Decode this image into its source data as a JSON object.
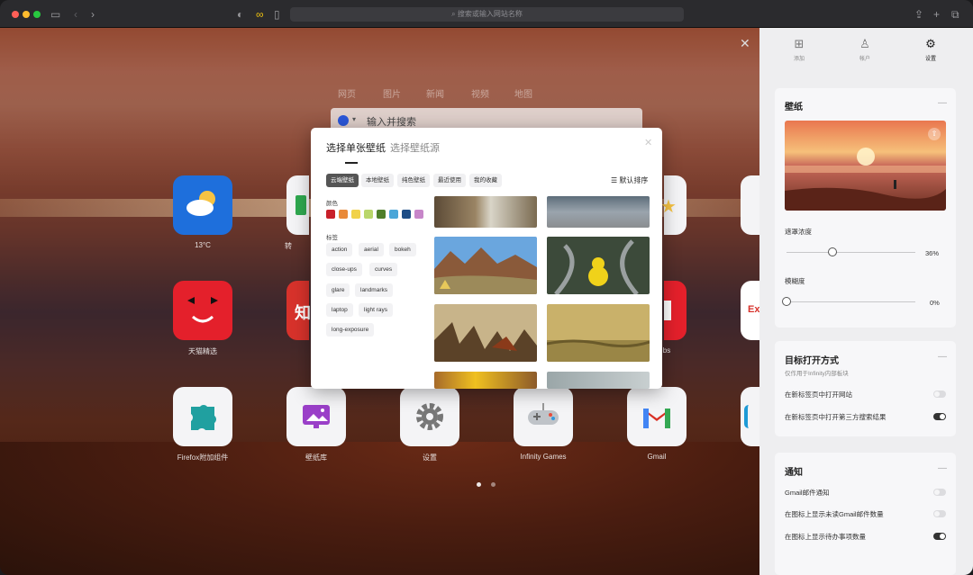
{
  "toolbar": {
    "url_placeholder": "搜索或输入网站名称"
  },
  "new_tab": {
    "search_tabs": [
      "网页",
      "图片",
      "新闻",
      "视频",
      "地图"
    ],
    "search_placeholder": "输入并搜索",
    "tiles": [
      {
        "label": "13°C",
        "icon": "weather-icon",
        "color": "#1e6fdc"
      },
      {
        "label": "转",
        "icon": "green-app-icon",
        "color": "#2fa84f"
      },
      {
        "label": "天猫精选",
        "icon": "tmall-icon",
        "color": "#e4202b"
      },
      {
        "label": "知",
        "icon": "red-app-icon",
        "color": "#d7322b"
      },
      {
        "label": "Firefox附加组件",
        "icon": "puzzle-icon",
        "color": "#f4f4f6"
      },
      {
        "label": "壁纸库",
        "icon": "wallpaper-icon",
        "color": "#f4f4f6"
      },
      {
        "label": "设置",
        "icon": "gear-icon",
        "color": "#f4f4f6"
      },
      {
        "label": "Infinity Games",
        "icon": "gamepad-icon",
        "color": "#f4f4f6"
      },
      {
        "label": "Gmail",
        "icon": "gmail-icon",
        "color": "#f4f4f6"
      },
      {
        "label": "bs",
        "icon": "red-tile-icon",
        "color": "#e4202b"
      },
      {
        "label": "Ex",
        "icon": "ex-icon",
        "color": "#ffffff"
      }
    ],
    "page_dots": 2,
    "active_dot": 1
  },
  "modal": {
    "tab_active": "选择单张壁纸",
    "tab_inactive": "选择壁纸源",
    "chips": [
      "云端壁纸",
      "本地壁纸",
      "纯色壁纸",
      "最近使用",
      "我的收藏"
    ],
    "active_chip": "云端壁纸",
    "sort_label": "默认排序",
    "color_section": "颜色",
    "colors": [
      "#c8202a",
      "#e98a3a",
      "#f1d24a",
      "#b9d66a",
      "#4f7f2a",
      "#4aa6d8",
      "#1d4d86",
      "#c786c9"
    ],
    "tag_section": "标签",
    "tags": [
      "action",
      "aerial",
      "bokeh",
      "close-ups",
      "curves",
      "glare",
      "landmarks",
      "laptop",
      "light rays",
      "long-exposure"
    ]
  },
  "panel": {
    "tabs": [
      "添加",
      "帐户",
      "设置"
    ],
    "active_tab": "设置",
    "wallpaper": {
      "title": "壁纸",
      "mask_label": "遮罩浓度",
      "mask_value": "36%",
      "mask_fraction": 0.36,
      "blur_label": "模糊度",
      "blur_value": "0%",
      "blur_fraction": 0
    },
    "open_mode": {
      "title": "目标打开方式",
      "subtitle": "仅作用于Infinity内部板块",
      "item1": "在新标签页中打开网站",
      "item1_on": false,
      "item2": "在新标签页中打开第三方搜索结果",
      "item2_on": true
    },
    "notify": {
      "title": "通知",
      "item1": "Gmail邮件通知",
      "item1_on": false,
      "item2": "在图标上显示未读Gmail邮件数量",
      "item2_on": false,
      "item3": "在图标上显示待办事项数量",
      "item3_on": true
    }
  }
}
